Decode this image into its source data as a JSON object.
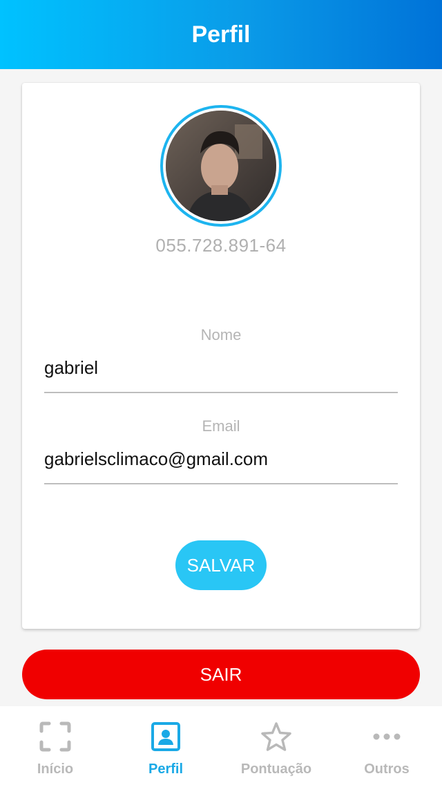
{
  "header": {
    "title": "Perfil"
  },
  "profile": {
    "cpf": "055.728.891-64",
    "name_label": "Nome",
    "name_value": "gabriel",
    "email_label": "Email",
    "email_value": "gabrielsclimaco@gmail.com",
    "save_label": "SALVAR"
  },
  "logout_label": "SAIR",
  "tabs": [
    {
      "label": "Início",
      "icon": "scan-frame-icon",
      "active": false
    },
    {
      "label": "Perfil",
      "icon": "profile-card-icon",
      "active": true
    },
    {
      "label": "Pontuação",
      "icon": "star-icon",
      "active": false
    },
    {
      "label": "Outros",
      "icon": "more-dots-icon",
      "active": false
    }
  ],
  "colors": {
    "header_gradient": [
      "#00c2ff",
      "#0072d8"
    ],
    "accent": "#1aa9e6",
    "save_button": "#29c6f5",
    "logout_button": "#f00000",
    "inactive_tab": "#b9b9b9"
  }
}
